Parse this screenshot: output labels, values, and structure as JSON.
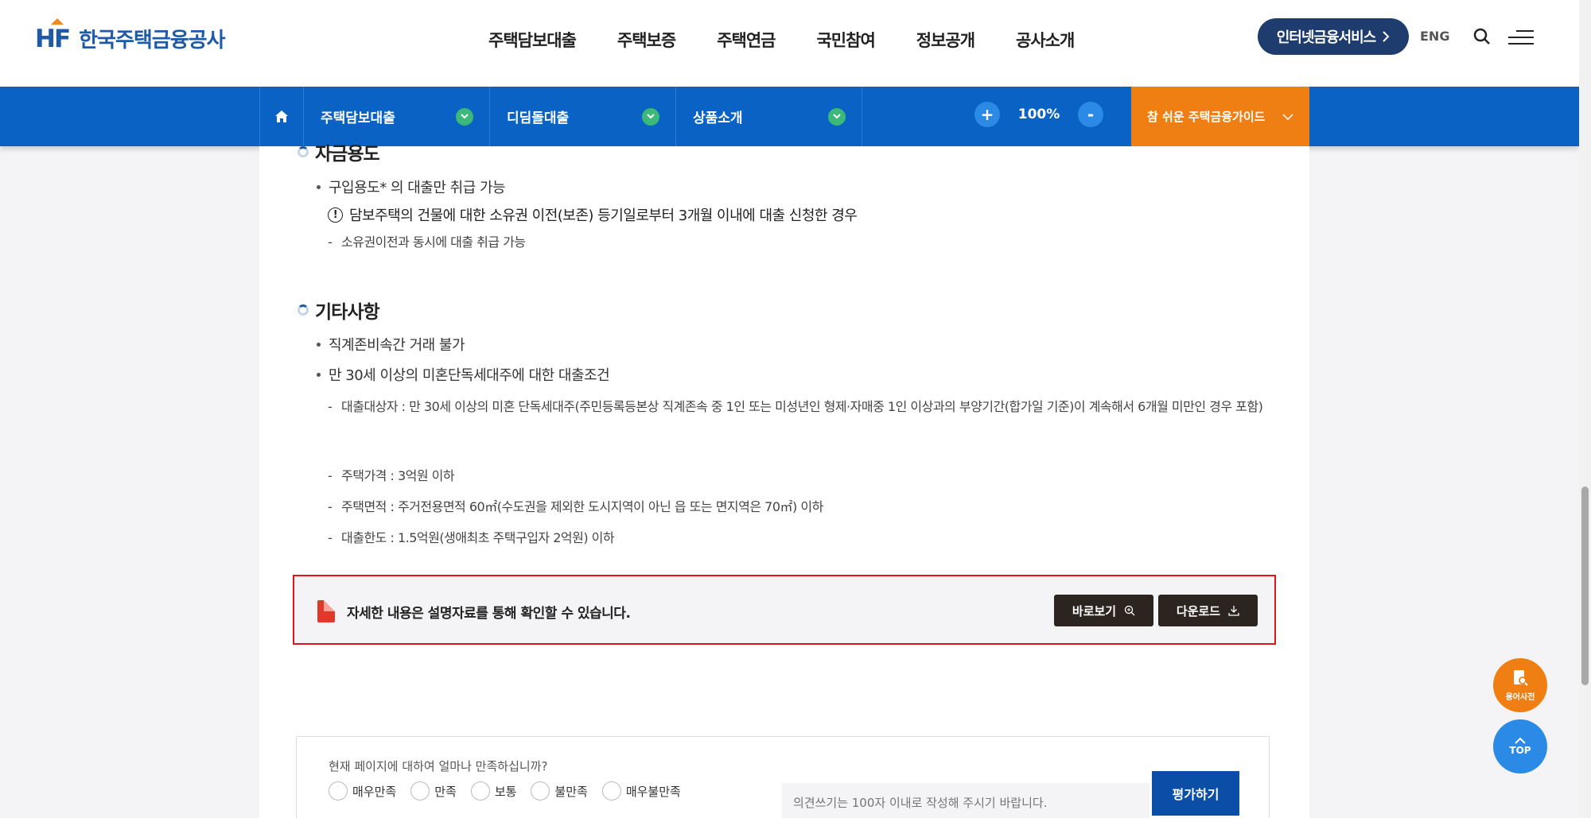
{
  "header": {
    "logo_mark": "HF",
    "logo_text": "한국주택금융공사",
    "nav": [
      "주택담보대출",
      "주택보증",
      "주택연금",
      "국민참여",
      "정보공개",
      "공사소개"
    ],
    "inet_label": "인터넷금융서비스",
    "eng_label": "ENG"
  },
  "subnav": {
    "items": [
      "주택담보대출",
      "디딤돌대출",
      "상품소개"
    ],
    "zoom_plus": "+",
    "zoom_value": "100%",
    "zoom_minus": "-",
    "guide_label": "참 쉬운 주택금융가이드"
  },
  "content": {
    "section1_title": "자금용도",
    "s1_bullet1": "구입용도* 의 대출만 취급 가능",
    "s1_notice": "담보주택의 건물에 대한 소유권 이전(보존) 등기일로부터 3개월 이내에 대출 신청한 경우",
    "s1_dash1": "소유권이전과 동시에 대출 취급 가능",
    "section2_title": "기타사항",
    "s2_bullet1": "직계존비속간 거래 불가",
    "s2_bullet2": "만 30세 이상의 미혼단독세대주에 대한 대출조건",
    "s2_dashes": [
      "대출대상자 : 만 30세 이상의 미혼 단독세대주(주민등록등본상 직계존속 중 1인 또는 미성년인 형제·자매중 1인 이상과의 부양기간(합가일 기준)이 계속해서 6개월 미만인 경우 포함)",
      "주택가격 : 3억원 이하",
      "주택면적 : 주거전용면적 60㎡(수도권을 제외한 도시지역이 아닌 읍 또는 면지역은 70㎡) 이하",
      "대출한도 : 1.5억원(생애최초 주택구입자 2억원) 이하"
    ],
    "doc_text": "자세한 내용은 설명자료를 통해 확인할 수 있습니다.",
    "view_label": "바로보기",
    "download_label": "다운로드"
  },
  "survey": {
    "question": "현재 페이지에 대하여 얼마나 만족하십니까?",
    "options": [
      "매우만족",
      "만족",
      "보통",
      "불만족",
      "매우불만족"
    ],
    "placeholder": "의견쓰기는 100자 이내로 작성해 주시기 바랍니다.",
    "submit_label": "평가하기"
  },
  "floating": {
    "dict_label": "용어사전",
    "top_label": "TOP"
  },
  "colors": {
    "brand_blue": "#1f5aa6",
    "subnav_blue": "#0a63c4",
    "accent_orange": "#f07f13",
    "highlight_red": "#e2141a"
  }
}
